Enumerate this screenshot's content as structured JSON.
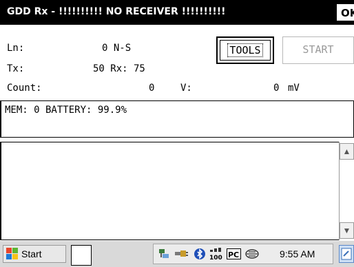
{
  "titlebar": {
    "title": "GDD Rx - !!!!!!!!!! NO RECEIVER !!!!!!!!!!",
    "ok_label": "OK"
  },
  "fields": {
    "ln_label": "Ln:",
    "ln_value": "0 N-S",
    "tx_label": "Tx:",
    "tx_value": "50 Rx: 75",
    "count_label": "Count:",
    "count_value": "0",
    "v_label": "V:",
    "v_value": "0",
    "v_unit": "mV"
  },
  "buttons": {
    "tools_label": "TOOLS",
    "start_label": "START"
  },
  "status": {
    "mem_text": "MEM: 0 BATTERY: 99.9%"
  },
  "taskbar": {
    "start_label": "Start",
    "time": "9:55 AM",
    "tray_icons": [
      "network-icon",
      "power-plug-icon",
      "bluetooth-icon",
      "signal-100-icon",
      "pc-icon",
      "connection-icon"
    ]
  },
  "colors": {
    "titlebar_bg": "#000000",
    "titlebar_fg": "#ffffff",
    "disabled_text": "#9a9a9a",
    "taskbar_bg": "#d9d9d9"
  }
}
